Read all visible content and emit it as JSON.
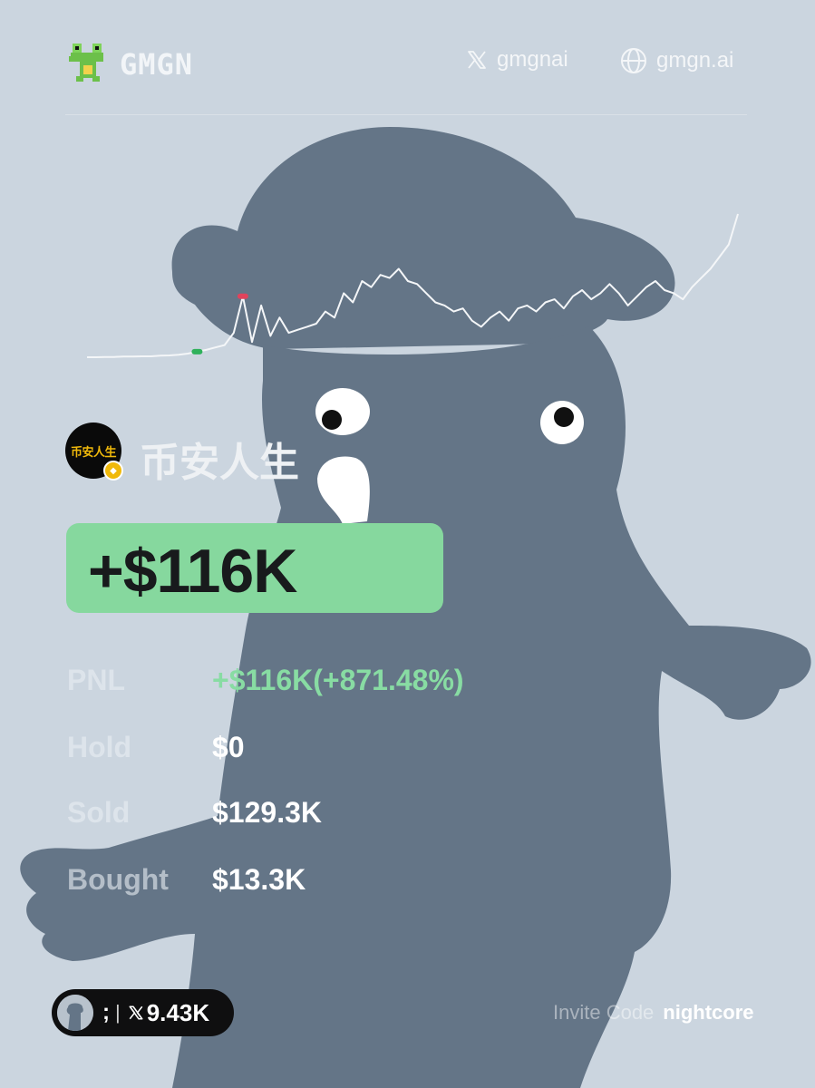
{
  "brand": {
    "name": "GMGN",
    "logo_icon": "frog-icon"
  },
  "links": {
    "x_handle": "gmgnai",
    "website": "gmgn.ai",
    "x_icon": "x-logo-icon",
    "web_icon": "globe-icon"
  },
  "user": {
    "name": "币安人生",
    "avatar_text": "币安人生",
    "badge_icon": "binance-coin-icon"
  },
  "pnl": {
    "headline": "+$116K",
    "box_color": "#86d89e"
  },
  "stats": [
    {
      "label": "PNL",
      "value": "+$116K(+871.48%)",
      "color": "#88dca3"
    },
    {
      "label": "Hold",
      "value": "$0",
      "color": "#ffffff"
    },
    {
      "label": "Sold",
      "value": "$129.3K",
      "color": "#ffffff"
    },
    {
      "label": "Bought",
      "value": "$13.3K",
      "color": "#ffffff"
    }
  ],
  "chart_data": {
    "type": "line",
    "series": [
      {
        "values": [
          1,
          1,
          1.1,
          1.1,
          1.2,
          1.2,
          1.3,
          1.3,
          1.5,
          1.6,
          1.8,
          2.2,
          2.8,
          3.4,
          4.2,
          5,
          9,
          21,
          6,
          18,
          8,
          14,
          9,
          10,
          11,
          12,
          16,
          14,
          22,
          19,
          26,
          24,
          28,
          27,
          30,
          26,
          25,
          22,
          19,
          18,
          16,
          17,
          13,
          11,
          14,
          16,
          13,
          17,
          18,
          16,
          19,
          20,
          17,
          21,
          23,
          20,
          22,
          25,
          22,
          18,
          21,
          24,
          26,
          23,
          22,
          20,
          24,
          27,
          30,
          34,
          38,
          48
        ]
      }
    ],
    "markers": [
      {
        "index": 12,
        "kind": "buy",
        "color": "#2fb15b"
      },
      {
        "index": 17,
        "kind": "sell",
        "color": "#e0435c"
      }
    ],
    "line_color": "#f4f6f8",
    "grid": false
  },
  "referral": {
    "handle": ";",
    "separator": "|",
    "x_icon": "x-logo-icon",
    "followers": "9.43K"
  },
  "invite": {
    "label": "Invite Code",
    "code": "nightcore"
  },
  "colors": {
    "background": "#cbd5df",
    "figure": "#647587",
    "accent_green": "#86d89e"
  }
}
